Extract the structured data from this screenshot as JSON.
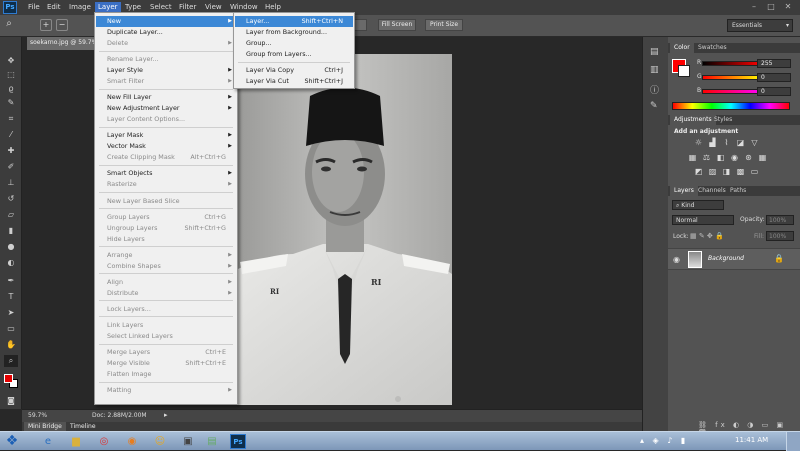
{
  "app": {
    "logo": "Ps"
  },
  "menubar": {
    "items": [
      "File",
      "Edit",
      "Image",
      "Layer",
      "Type",
      "Select",
      "Filter",
      "View",
      "Window",
      "Help"
    ],
    "active": "Layer",
    "active_color": "#3b6fc4"
  },
  "window_controls": [
    "–",
    "□",
    "✕"
  ],
  "options_bar": {
    "buttons": [
      "Fill Screen",
      "Print Size"
    ],
    "workspace": "Essentials"
  },
  "document": {
    "tab_title": "soekarno.jpg @ 59.7% (RGB/8)",
    "zoom": "59.7%",
    "doc_size": "Doc: 2.88M/2.00M"
  },
  "bottom_tabs": [
    "Mini Bridge",
    "Timeline"
  ],
  "layer_menu": {
    "items": [
      {
        "label": "New",
        "shortcut": "",
        "submenu": true,
        "highlighted": true
      },
      {
        "label": "Duplicate Layer...",
        "shortcut": ""
      },
      {
        "label": "Delete",
        "shortcut": "",
        "submenu": true,
        "disabled": true
      },
      {
        "label": "Rename Layer...",
        "shortcut": "",
        "disabled": true
      },
      {
        "label": "Layer Style",
        "shortcut": "",
        "submenu": true
      },
      {
        "label": "Smart Filter",
        "shortcut": "",
        "submenu": true,
        "disabled": true
      },
      {
        "label": "New Fill Layer",
        "shortcut": "",
        "submenu": true
      },
      {
        "label": "New Adjustment Layer",
        "shortcut": "",
        "submenu": true
      },
      {
        "label": "Layer Content Options...",
        "shortcut": "",
        "disabled": true
      },
      {
        "label": "Layer Mask",
        "shortcut": "",
        "submenu": true
      },
      {
        "label": "Vector Mask",
        "shortcut": "",
        "submenu": true
      },
      {
        "label": "Create Clipping Mask",
        "shortcut": "Alt+Ctrl+G",
        "disabled": true
      },
      {
        "label": "Smart Objects",
        "shortcut": "",
        "submenu": true
      },
      {
        "label": "Rasterize",
        "shortcut": "",
        "submenu": true,
        "disabled": true
      },
      {
        "label": "New Layer Based Slice",
        "shortcut": "",
        "disabled": true
      },
      {
        "label": "Group Layers",
        "shortcut": "Ctrl+G",
        "disabled": true
      },
      {
        "label": "Ungroup Layers",
        "shortcut": "Shift+Ctrl+G",
        "disabled": true
      },
      {
        "label": "Hide Layers",
        "shortcut": "",
        "disabled": true
      },
      {
        "label": "Arrange",
        "shortcut": "",
        "submenu": true,
        "disabled": true
      },
      {
        "label": "Combine Shapes",
        "shortcut": "",
        "submenu": true,
        "disabled": true
      },
      {
        "label": "Align",
        "shortcut": "",
        "submenu": true,
        "disabled": true
      },
      {
        "label": "Distribute",
        "shortcut": "",
        "submenu": true,
        "disabled": true
      },
      {
        "label": "Lock Layers...",
        "shortcut": "",
        "disabled": true
      },
      {
        "label": "Link Layers",
        "shortcut": "",
        "disabled": true
      },
      {
        "label": "Select Linked Layers",
        "shortcut": "",
        "disabled": true
      },
      {
        "label": "Merge Layers",
        "shortcut": "Ctrl+E",
        "disabled": true
      },
      {
        "label": "Merge Visible",
        "shortcut": "Shift+Ctrl+E",
        "disabled": true
      },
      {
        "label": "Flatten Image",
        "shortcut": "",
        "disabled": true
      },
      {
        "label": "Matting",
        "shortcut": "",
        "submenu": true,
        "disabled": true
      }
    ],
    "separator_after": [
      2,
      5,
      8,
      11,
      13,
      14,
      17,
      19,
      21,
      22,
      24,
      27
    ]
  },
  "new_submenu": {
    "items": [
      {
        "label": "Layer...",
        "shortcut": "Shift+Ctrl+N",
        "highlighted": true
      },
      {
        "label": "Layer from Background...",
        "shortcut": ""
      },
      {
        "label": "Group...",
        "shortcut": ""
      },
      {
        "label": "Group from Layers...",
        "shortcut": ""
      },
      {
        "label": "Layer Via Copy",
        "shortcut": "Ctrl+J"
      },
      {
        "label": "Layer Via Cut",
        "shortcut": "Shift+Ctrl+J"
      }
    ],
    "separator_after": [
      3
    ]
  },
  "color_panel": {
    "tabs": [
      "Color",
      "Swatches"
    ],
    "channels": [
      {
        "label": "R",
        "value": "255",
        "color": "#ff0000"
      },
      {
        "label": "G",
        "value": "0",
        "color": "#00cc00"
      },
      {
        "label": "B",
        "value": "0",
        "color": "#0000ff"
      }
    ],
    "foreground": "#ff0000"
  },
  "adjustments_panel": {
    "tabs": [
      "Adjustments",
      "Styles"
    ],
    "heading": "Add an adjustment"
  },
  "layers_panel": {
    "tabs": [
      "Layers",
      "Channels",
      "Paths"
    ],
    "filter": "Kind",
    "blend_mode": "Normal",
    "opacity_label": "Opacity:",
    "opacity_value": "100%",
    "lock_label": "Lock:",
    "fill_label": "Fill:",
    "fill_value": "100%",
    "layer_name": "Background"
  },
  "photo": {
    "badge_left": "RI",
    "badge_right": "RI"
  },
  "taskbar": {
    "time": "11:41 AM"
  }
}
